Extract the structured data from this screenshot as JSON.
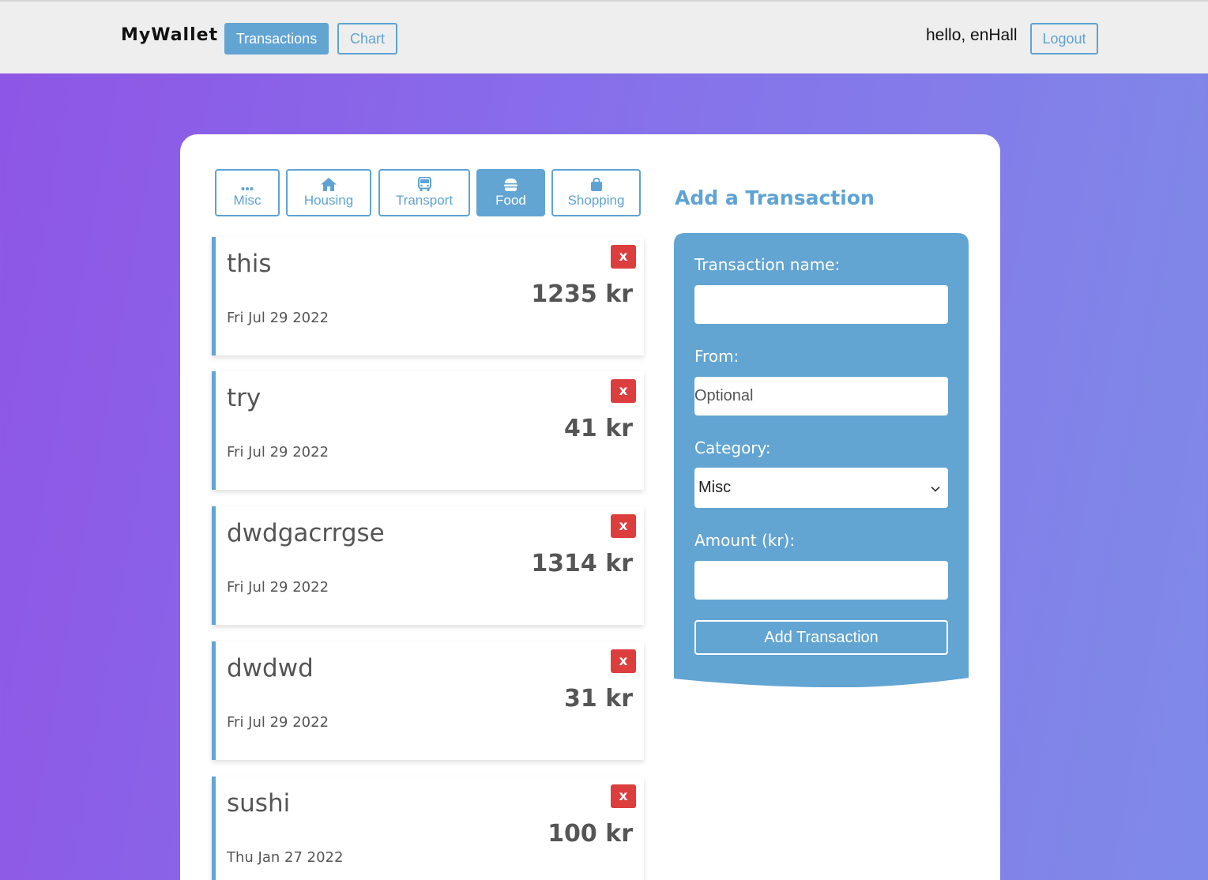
{
  "nav": {
    "brand": "MyWallet",
    "transactions_label": "Transactions",
    "chart_label": "Chart",
    "greeting": "hello, enHall",
    "logout_label": "Logout"
  },
  "categories": [
    {
      "label": "Misc",
      "icon": "ellipsis-icon",
      "active": false
    },
    {
      "label": "Housing",
      "icon": "house-icon",
      "active": false
    },
    {
      "label": "Transport",
      "icon": "bus-icon",
      "active": false
    },
    {
      "label": "Food",
      "icon": "burger-icon",
      "active": true
    },
    {
      "label": "Shopping",
      "icon": "shopping-bag-icon",
      "active": false
    }
  ],
  "transactions": [
    {
      "name": "this",
      "amount": "1235 kr",
      "date": "Fri Jul 29 2022",
      "delete_label": "x"
    },
    {
      "name": "try",
      "amount": "41 kr",
      "date": "Fri Jul 29 2022",
      "delete_label": "x"
    },
    {
      "name": "dwdgacrrgse",
      "amount": "1314 kr",
      "date": "Fri Jul 29 2022",
      "delete_label": "x"
    },
    {
      "name": "dwdwd",
      "amount": "31 kr",
      "date": "Fri Jul 29 2022",
      "delete_label": "x"
    },
    {
      "name": "sushi",
      "amount": "100 kr",
      "date": "Thu Jan 27 2022",
      "delete_label": "x"
    }
  ],
  "form": {
    "title": "Add a Transaction",
    "name_label": "Transaction name:",
    "name_value": "",
    "from_label": "From:",
    "from_placeholder": "Optional",
    "category_label": "Category:",
    "category_value": "Misc",
    "amount_label": "Amount (kr):",
    "amount_value": "",
    "submit_label": "Add Transaction"
  },
  "colors": {
    "accent": "#62a4d2",
    "delete": "#dc3e3e",
    "gradient_start": "#8e55e6",
    "gradient_end": "#7f8ae8"
  }
}
